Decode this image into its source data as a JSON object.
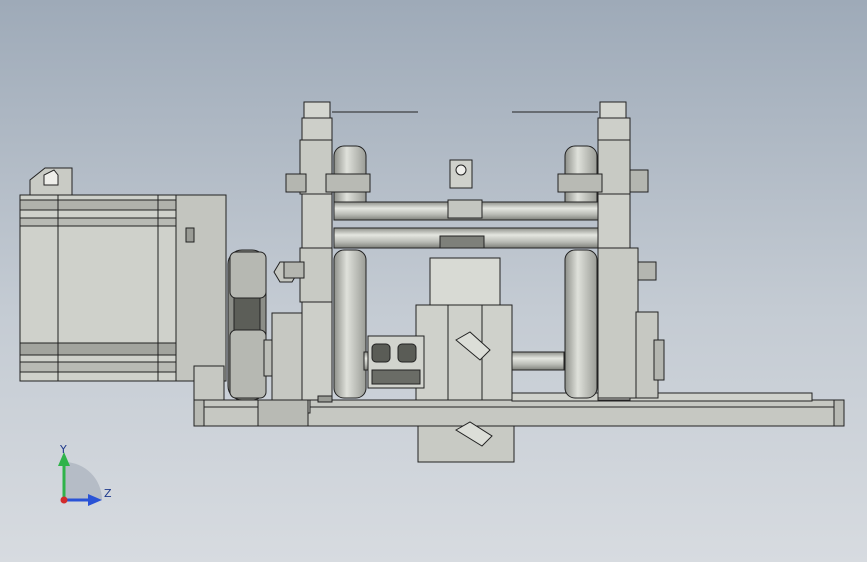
{
  "viewport": {
    "background_top": "#9eaab8",
    "background_bottom": "#d7dbe0"
  },
  "triad": {
    "y_label": "Y",
    "z_label": "Z",
    "y_color": "#2fb34a",
    "z_color": "#2a53d6",
    "origin_color": "#d22b2b"
  },
  "model": {
    "part_fill": "#c9cbc5",
    "part_light": "#dcded8",
    "part_dark": "#9a9c96",
    "edge_color": "#222222"
  }
}
